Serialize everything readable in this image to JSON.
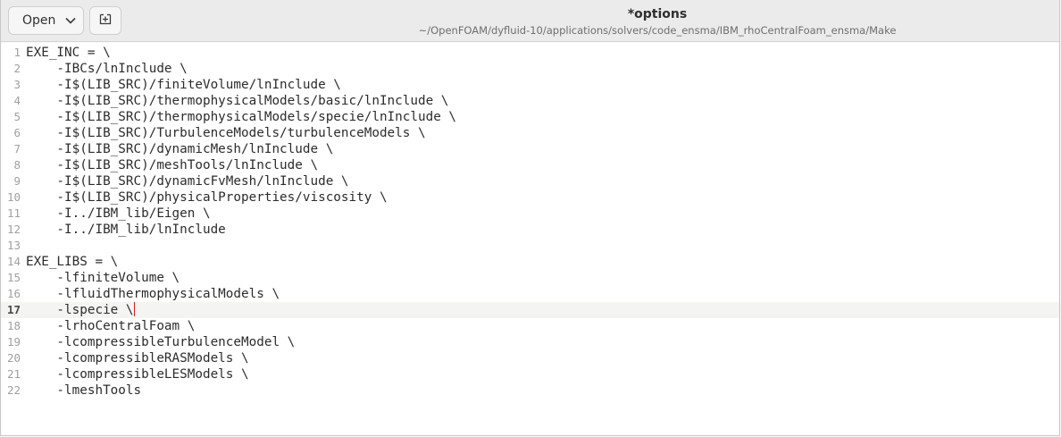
{
  "header": {
    "open_label": "Open",
    "title": "*options",
    "path": "~/OpenFOAM/dyfluid-10/applications/solvers/code_ensma/IBM_rhoCentralFoam_ensma/Make"
  },
  "editor": {
    "current_line": 17,
    "lines": [
      {
        "n": "1",
        "text": "EXE_INC = \\"
      },
      {
        "n": "2",
        "text": "    -IBCs/lnInclude \\"
      },
      {
        "n": "3",
        "text": "    -I$(LIB_SRC)/finiteVolume/lnInclude \\"
      },
      {
        "n": "4",
        "text": "    -I$(LIB_SRC)/thermophysicalModels/basic/lnInclude \\"
      },
      {
        "n": "5",
        "text": "    -I$(LIB_SRC)/thermophysicalModels/specie/lnInclude \\"
      },
      {
        "n": "6",
        "text": "    -I$(LIB_SRC)/TurbulenceModels/turbulenceModels \\"
      },
      {
        "n": "7",
        "text": "    -I$(LIB_SRC)/dynamicMesh/lnInclude \\"
      },
      {
        "n": "8",
        "text": "    -I$(LIB_SRC)/meshTools/lnInclude \\"
      },
      {
        "n": "9",
        "text": "    -I$(LIB_SRC)/dynamicFvMesh/lnInclude \\"
      },
      {
        "n": "10",
        "text": "    -I$(LIB_SRC)/physicalProperties/viscosity \\"
      },
      {
        "n": "11",
        "text": "    -I../IBM_lib/Eigen \\"
      },
      {
        "n": "12",
        "text": "    -I../IBM_lib/lnInclude"
      },
      {
        "n": "13",
        "text": ""
      },
      {
        "n": "14",
        "text": "EXE_LIBS = \\"
      },
      {
        "n": "15",
        "text": "    -lfiniteVolume \\"
      },
      {
        "n": "16",
        "text": "    -lfluidThermophysicalModels \\"
      },
      {
        "n": "17",
        "text": "    -lspecie \\"
      },
      {
        "n": "18",
        "text": "    -lrhoCentralFoam \\"
      },
      {
        "n": "19",
        "text": "    -lcompressibleTurbulenceModel \\"
      },
      {
        "n": "20",
        "text": "    -lcompressibleRASModels \\"
      },
      {
        "n": "21",
        "text": "    -lcompressibleLESModels \\"
      },
      {
        "n": "22",
        "text": "    -lmeshTools"
      }
    ]
  },
  "icons": {
    "open_menu": "chevron-down-icon",
    "new_tab": "new-tab-icon"
  }
}
